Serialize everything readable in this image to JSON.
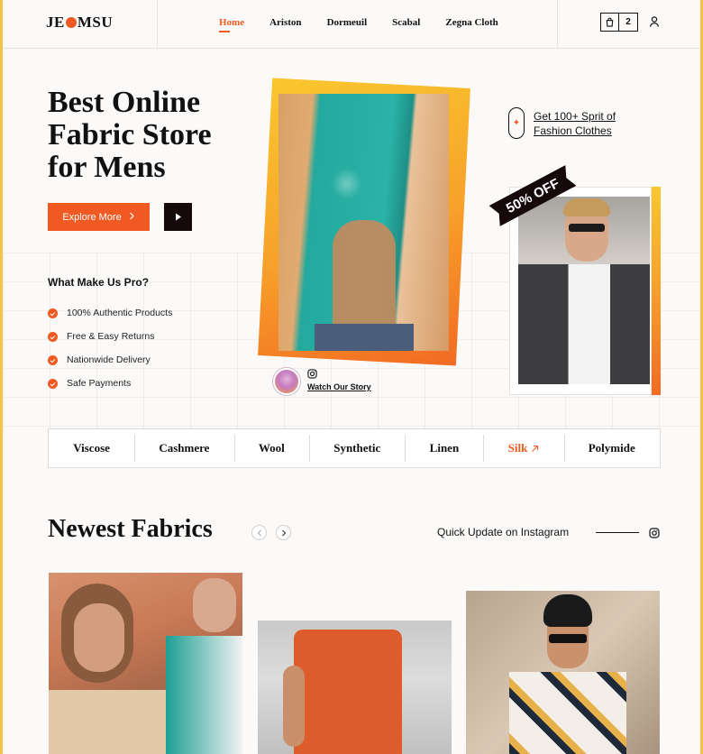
{
  "brand": {
    "logo_left": "JE",
    "logo_right": "MSU"
  },
  "nav": {
    "items": [
      {
        "label": "Home",
        "active": true
      },
      {
        "label": "Ariston",
        "active": false
      },
      {
        "label": "Dormeuil",
        "active": false
      },
      {
        "label": "Scabal",
        "active": false
      },
      {
        "label": "Zegna Cloth",
        "active": false
      }
    ],
    "cart_count": "2"
  },
  "hero": {
    "title_lines": [
      "Best Online",
      "Fabric Store",
      "for Mens"
    ],
    "explore_label": "Explore More",
    "pro_title": "What Make Us Pro?",
    "pro_items": [
      "100% Authentic Products",
      "Free & Easy Returns",
      "Nationwide Delivery",
      "Safe Payments"
    ],
    "watch_story": "Watch Our Story"
  },
  "promo": {
    "sprit_lines": [
      "Get 100+ Sprit of",
      "Fashion Clothes"
    ],
    "discount": "50% OFF"
  },
  "fabrics": [
    "Viscose",
    "Cashmere",
    "Wool",
    "Synthetic",
    "Linen",
    "Silk",
    "Polymide"
  ],
  "fabrics_highlight": "Silk",
  "newest": {
    "title": "Newest Fabrics",
    "instagram": "Quick Update on Instagram"
  },
  "colors": {
    "accent": "#f05a22",
    "dark": "#16090b",
    "gold": "#f9c72e"
  },
  "icons": [
    "bag-icon",
    "user-icon",
    "play-icon",
    "check-icon",
    "sparkle-icon",
    "instagram-icon",
    "chevron-left-icon",
    "chevron-right-icon",
    "arrow-up-right-icon"
  ]
}
